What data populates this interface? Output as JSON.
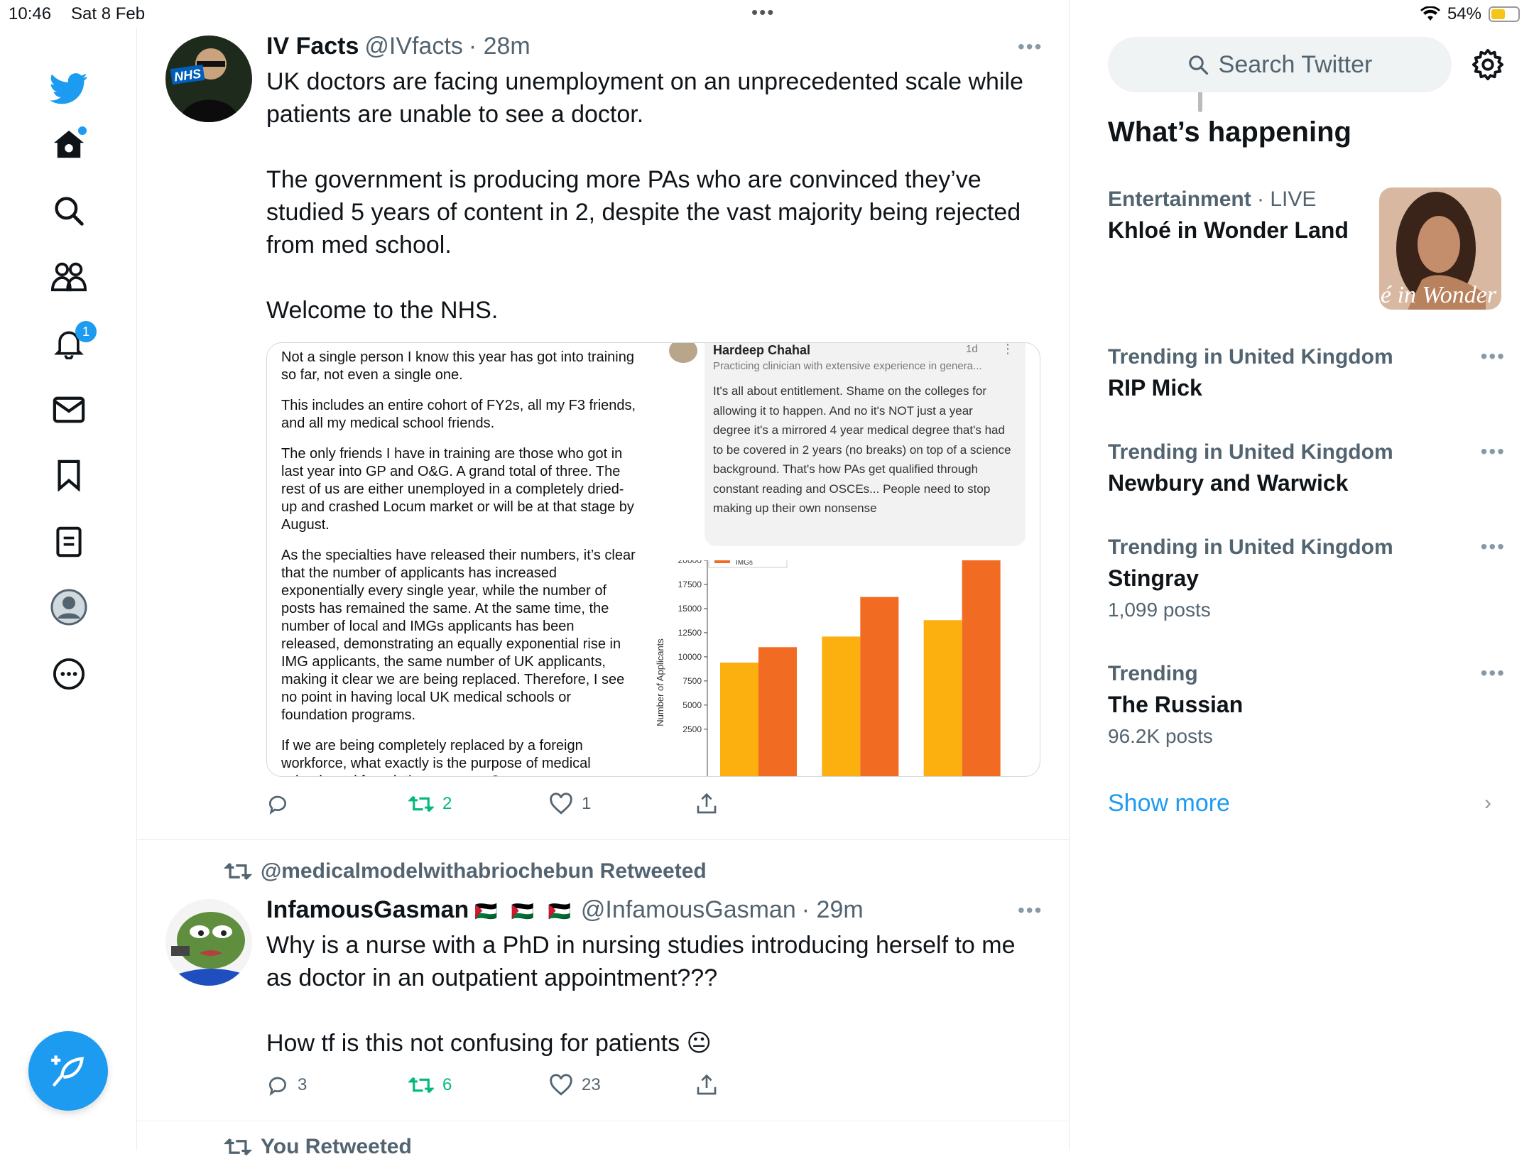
{
  "status_bar": {
    "time": "10:46",
    "date": "Sat 8 Feb",
    "battery": "54%",
    "battery_level": 0.54
  },
  "nav": {
    "notifications_badge": "1",
    "items": [
      "home",
      "explore",
      "communities",
      "notifications",
      "messages",
      "bookmarks",
      "lists",
      "profile",
      "more"
    ]
  },
  "timeline": {
    "tweets": [
      {
        "name": "IV Facts",
        "handle": "@IVfacts",
        "time": "· 28m",
        "text": "UK doctors are facing unemployment on an unprecedented scale while patients are unable to see a doctor.\n\nThe government is producing more PAs who are convinced they’ve studied 5 years of content in 2, despite the vast majority being rejected from med school.\n\nWelcome to the NHS.",
        "reply_count": "",
        "retweet_count": "2",
        "like_count": "1",
        "media": {
          "paragraphs": [
            "Not a single person I know this year has got into training so far, not even a single one.",
            "This includes an entire cohort of FY2s, all my F3 friends, and all my medical school friends.",
            "The only friends I have in training are those who got in last year into  GP and O&G. A grand total of three. The rest of us are either unemployed in a completely dried-up and crashed Locum market or will be at that stage by August.",
            "As the specialties have released their numbers, it’s clear that the number of applicants has increased exponentially every single year, while the number of posts has remained the same. At the same time, the number of local and IMGs applicants has been released, demonstrating an equally exponential rise in IMG applicants, the same number of UK applicants, making it clear we are being replaced. Therefore, I see no point in having local UK medical schools or foundation programs.",
            "If we are being completely replaced by a foreign workforce, what exactly is the purpose of medical schools and foundation programs?"
          ],
          "comment": {
            "author": "Hardeep Chahal",
            "time": "1d",
            "bio": "Practicing clinician with extensive experience in genera...",
            "text": "It's all about entitlement. Shame on the colleges for allowing it to happen. And no it's NOT just a year degree it's a mirrored 4 year medical degree that's had to be covered in 2 years (no breaks) on top of a science background. That's how PAs get qualified through constant reading and OSCEs... People need to stop making up their own nonsense"
          }
        }
      },
      {
        "retweeted_by": "@medicalmodelwithabriochebun Retweeted",
        "name": "InfamousGasman",
        "flags": "🇵🇸 🇵🇸 🇵🇸",
        "handle": "@InfamousGasman",
        "time": "· 29m",
        "text": "Why is a nurse with a PhD in nursing studies introducing herself to me as doctor in an outpatient appointment???\n\nHow tf is this not confusing for patients 😐",
        "reply_count": "3",
        "retweet_count": "6",
        "like_count": "23"
      }
    ],
    "next_context": "You Retweeted"
  },
  "chart_data": {
    "type": "bar",
    "ylabel": "Number of Applicants",
    "yticks": [
      "2500",
      "5000",
      "7500",
      "10000",
      "12500",
      "15000",
      "17500",
      "20000"
    ],
    "ylim": [
      0,
      20000
    ],
    "legend_entry": "IMGs",
    "groups": 3,
    "series": [
      {
        "values": [
          9400,
          12100,
          13800
        ],
        "color": "#fbb010"
      },
      {
        "values": [
          11000,
          16200,
          20000
        ],
        "color": "#f26b22"
      }
    ]
  },
  "sidebar": {
    "search_placeholder": "Search Twitter",
    "heading": "What’s happening",
    "trends": [
      {
        "context": "Entertainment",
        "context_extra": " · LIVE",
        "title": "Khloé in Wonder Land",
        "count": "",
        "image_text": "é in Wonder L"
      },
      {
        "context": "Trending in United Kingdom",
        "title": "RIP Mick",
        "count": ""
      },
      {
        "context": "Trending in United Kingdom",
        "title": "Newbury and Warwick",
        "count": ""
      },
      {
        "context": "Trending in United Kingdom",
        "title": "Stingray",
        "count": "1,099 posts"
      },
      {
        "context": "Trending",
        "title": "The Russian",
        "count": "96.2K posts"
      }
    ],
    "show_more": "Show more"
  },
  "colors": {
    "accent": "#1d9bf0",
    "retweet": "#00ba7c",
    "secondary_text": "#536471"
  }
}
